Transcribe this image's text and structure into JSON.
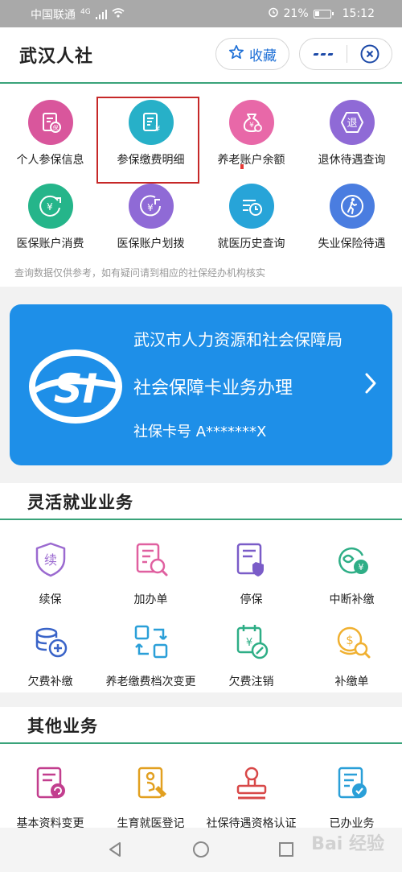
{
  "status_bar": {
    "carrier": "中国联通",
    "network": "4G",
    "battery": "21%",
    "time": "15:12"
  },
  "header": {
    "title": "武汉人社",
    "favorite_label": "收藏"
  },
  "top_services": [
    {
      "label": "个人参保信息",
      "icon": "shield-doc-icon",
      "color": "#d9569c"
    },
    {
      "label": "参保缴费明细",
      "icon": "yuan-receipt-icon",
      "color": "#27b0c8"
    },
    {
      "label": "养老账户余额",
      "icon": "money-bag-icon",
      "color": "#e868a8"
    },
    {
      "label": "退休待遇查询",
      "icon": "retire-icon",
      "color": "#8f6ad6"
    },
    {
      "label": "医保账户消费",
      "icon": "yuan-out-icon",
      "color": "#25b58a"
    },
    {
      "label": "医保账户划拨",
      "icon": "yuan-in-icon",
      "color": "#8f6ad6"
    },
    {
      "label": "就医历史查询",
      "icon": "history-icon",
      "color": "#27a4d8"
    },
    {
      "label": "失业保险待遇",
      "icon": "walker-icon",
      "color": "#4a7de0"
    }
  ],
  "note": "查询数据仅供参考，如有疑问请到相应的社保经办机构核实",
  "card": {
    "logo_text": "SI",
    "org": "武汉市人力资源和社会保障局",
    "service": "社会保障卡业务办理",
    "card_no_label": "社保卡号 A*******X"
  },
  "flex_section": {
    "title": "灵活就业业务",
    "items": [
      {
        "label": "续保",
        "icon": "renew-icon"
      },
      {
        "label": "加办单",
        "icon": "add-form-icon"
      },
      {
        "label": "停保",
        "icon": "stop-insurance-icon"
      },
      {
        "label": "中断补缴",
        "icon": "interrupt-pay-icon"
      },
      {
        "label": "欠费补缴",
        "icon": "coins-add-icon"
      },
      {
        "label": "养老缴费档次变更",
        "icon": "exchange-icon"
      },
      {
        "label": "欠费注销",
        "icon": "calendar-cancel-icon"
      },
      {
        "label": "补缴单",
        "icon": "coin-search-icon"
      }
    ]
  },
  "other_section": {
    "title": "其他业务",
    "items": [
      {
        "label": "基本资料变更",
        "icon": "profile-change-icon"
      },
      {
        "label": "生育就医登记",
        "icon": "maternity-icon"
      },
      {
        "label": "社保待遇资格认证",
        "icon": "stamp-icon"
      },
      {
        "label": "已办业务",
        "icon": "done-doc-icon"
      }
    ]
  },
  "watermark": "Bai 经验"
}
